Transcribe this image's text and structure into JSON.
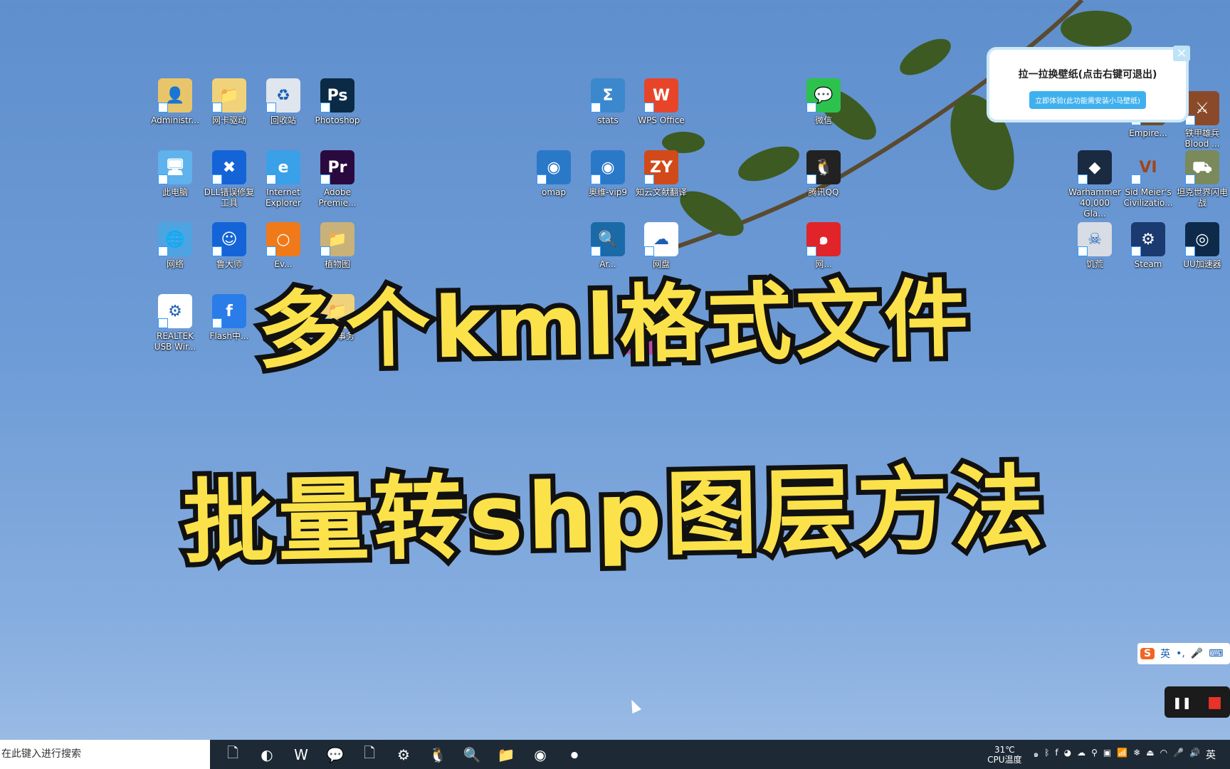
{
  "desktop_icons": [
    {
      "label": "Administr...",
      "icon": "user-folder-icon",
      "bg": "#e8c56a",
      "glyph": "👤"
    },
    {
      "label": "网卡驱动",
      "icon": "folder-icon",
      "bg": "#f0d27a",
      "glyph": "📁"
    },
    {
      "label": "回收站",
      "icon": "recycle-bin-icon",
      "bg": "#dfe6ee",
      "glyph": "♻"
    },
    {
      "label": "Photoshop",
      "icon": "photoshop-icon",
      "bg": "#0a2a45",
      "glyph": "Ps"
    },
    {
      "label": "此电脑",
      "icon": "computer-icon",
      "bg": "#5fb2ec",
      "glyph": "🖥"
    },
    {
      "label": "DLL错误修复工具",
      "icon": "wrench-icon",
      "bg": "#1464d8",
      "glyph": "✖"
    },
    {
      "label": "Internet Explorer",
      "icon": "ie-icon",
      "bg": "#3aa0e8",
      "glyph": "e"
    },
    {
      "label": "Adobe Premie...",
      "icon": "premiere-icon",
      "bg": "#2a0a3e",
      "glyph": "Pr"
    },
    {
      "label": "网络",
      "icon": "network-icon",
      "bg": "#4ea4e0",
      "glyph": "🌐"
    },
    {
      "label": "鲁大师",
      "icon": "ludashi-icon",
      "bg": "#1464d8",
      "glyph": "☺"
    },
    {
      "label": "Ev...",
      "icon": "everything-icon",
      "bg": "#f07a1a",
      "glyph": "○"
    },
    {
      "label": "植物图",
      "icon": "folder-icon",
      "bg": "#c9b27a",
      "glyph": "📁"
    },
    {
      "label": "REALTEK USB Wir...",
      "icon": "realtek-icon",
      "bg": "#ffffff",
      "glyph": "⚙"
    },
    {
      "label": "Flash中...",
      "icon": "flash-icon",
      "bg": "#2a7ce8",
      "glyph": "f"
    },
    {
      "label": "个人事务",
      "icon": "folder-icon",
      "bg": "#f0d27a",
      "glyph": "📁"
    },
    {
      "label": "stats",
      "icon": "stats-icon",
      "bg": "#3b88cc",
      "glyph": "Σ"
    },
    {
      "label": "WPS Office",
      "icon": "wps-icon",
      "bg": "#e8442a",
      "glyph": "W"
    },
    {
      "label": "微信",
      "icon": "wechat-icon",
      "bg": "#2dc24d",
      "glyph": "💬"
    },
    {
      "label": "omap",
      "icon": "omap-icon",
      "bg": "#2a78c8",
      "glyph": "◉"
    },
    {
      "label": "奥维-vip9",
      "icon": "ovital-icon",
      "bg": "#2a78c8",
      "glyph": "◉"
    },
    {
      "label": "知云文献翻译",
      "icon": "zhiyun-icon",
      "bg": "#d2491a",
      "glyph": "ZY"
    },
    {
      "label": "腾讯QQ",
      "icon": "qq-icon",
      "bg": "#222",
      "glyph": "🐧"
    },
    {
      "label": "Ar...",
      "icon": "arcgis-icon",
      "bg": "#1a6aa8",
      "glyph": "🔍"
    },
    {
      "label": "网盘",
      "icon": "baidu-netdisk-icon",
      "bg": "#ffffff",
      "glyph": "☁"
    },
    {
      "label": "网...",
      "icon": "netease-music-icon",
      "bg": "#e0242a",
      "glyph": "๑"
    },
    {
      "label": "Empire...",
      "icon": "empire-icon",
      "bg": "#6a5030",
      "glyph": "E"
    },
    {
      "label": "铁甲雄兵 Blood ...",
      "icon": "game-icon",
      "bg": "#8a4a2a",
      "glyph": "⚔"
    },
    {
      "label": "Warhammer 40,000 Gla...",
      "icon": "warhammer-icon",
      "bg": "#1a2a40",
      "glyph": "◆"
    },
    {
      "label": "Sid Meier's Civilizatio...",
      "icon": "civilization-icon",
      "bg": "transparent",
      "glyph": "VI"
    },
    {
      "label": "坦克世界闪电战",
      "icon": "tank-icon",
      "bg": "#7a8a5a",
      "glyph": "⛟"
    },
    {
      "label": "饥荒",
      "icon": "dont-starve-icon",
      "bg": "#d8dce4",
      "glyph": "☠"
    },
    {
      "label": "Steam",
      "icon": "steam-icon",
      "bg": "#1a3a70",
      "glyph": "⚙"
    },
    {
      "label": "UU加速器",
      "icon": "uu-icon",
      "bg": "#0e2a4a",
      "glyph": "◎"
    }
  ],
  "title": {
    "line1": "多个kml格式文件",
    "line2": "批量转shp图层方法",
    "color": "#fbe24a"
  },
  "popup": {
    "text": "拉一拉换壁纸(点击右键可退出)",
    "button": "立即体验(此功能需安装小马壁纸)",
    "close": "×"
  },
  "ime": {
    "logo": "S",
    "lang": "英",
    "punct": "•,",
    "mic": "🎤",
    "keyboard": "⌨"
  },
  "recorder": {
    "pause": "❚❚",
    "stop": "■"
  },
  "taskbar": {
    "search_placeholder": "在此键入进行搜索",
    "apps": [
      {
        "icon": "file-icon",
        "g": "🗋"
      },
      {
        "icon": "edge-icon",
        "g": "◐"
      },
      {
        "icon": "wps-icon",
        "g": "W"
      },
      {
        "icon": "wechat-icon",
        "g": "💬"
      },
      {
        "icon": "file-icon",
        "g": "🗋"
      },
      {
        "icon": "steam-icon",
        "g": "⚙"
      },
      {
        "icon": "qq-icon",
        "g": "🐧"
      },
      {
        "icon": "arcgis-icon",
        "g": "🔍"
      },
      {
        "icon": "file-explorer-icon",
        "g": "📁"
      },
      {
        "icon": "ovital-icon",
        "g": "◉"
      },
      {
        "icon": "recorder-icon",
        "g": "⏺"
      }
    ],
    "cpu_temp": "31℃",
    "cpu_label": "CPU温度",
    "tray": [
      "๑",
      "ᛒ",
      "f",
      "◕",
      "☁",
      "⚲",
      "▣",
      "📶",
      "❄",
      "⏏",
      "◠",
      "🎤",
      "🔊"
    ],
    "lang": "英"
  }
}
